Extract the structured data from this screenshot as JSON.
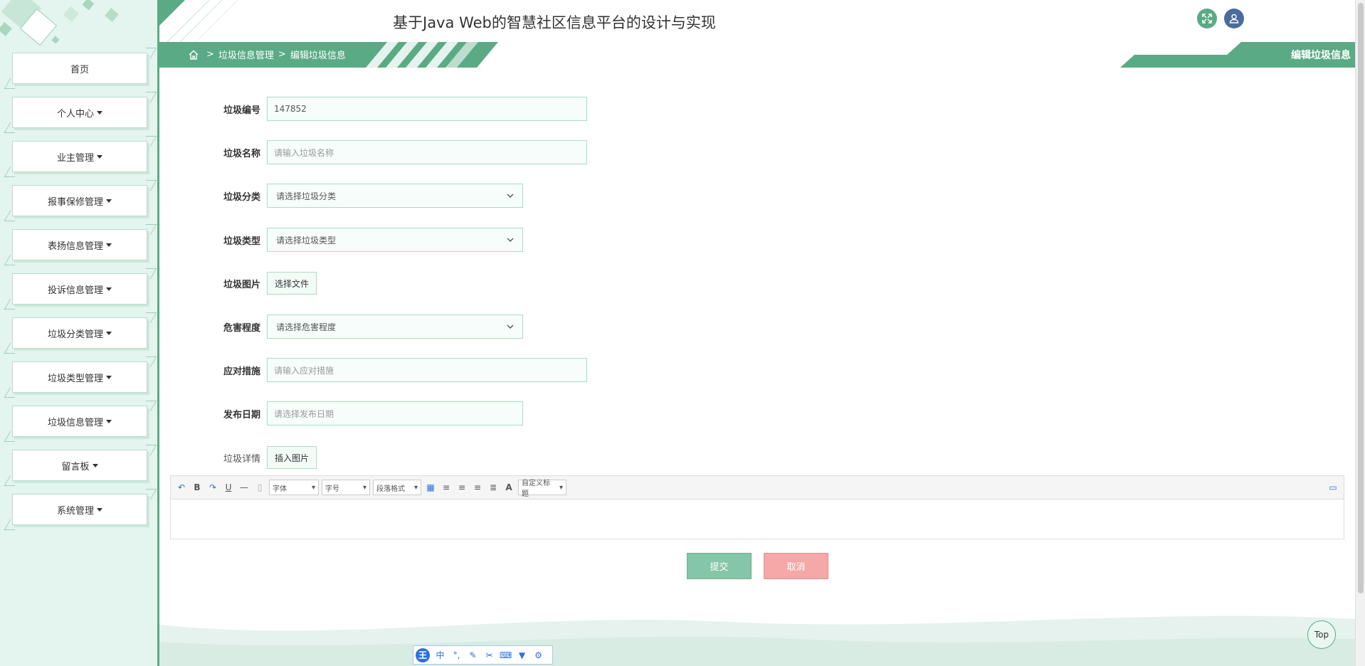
{
  "app": {
    "title": "基于Java Web的智慧社区信息平台的设计与实现"
  },
  "sidebar": {
    "items": [
      {
        "label": "首页",
        "has_caret": false
      },
      {
        "label": "个人中心",
        "has_caret": true
      },
      {
        "label": "业主管理",
        "has_caret": true
      },
      {
        "label": "报事保修管理",
        "has_caret": true
      },
      {
        "label": "表扬信息管理",
        "has_caret": true
      },
      {
        "label": "投诉信息管理",
        "has_caret": true
      },
      {
        "label": "垃圾分类管理",
        "has_caret": true
      },
      {
        "label": "垃圾类型管理",
        "has_caret": true
      },
      {
        "label": "垃圾信息管理",
        "has_caret": true
      },
      {
        "label": "留言板",
        "has_caret": true
      },
      {
        "label": "系统管理",
        "has_caret": true
      }
    ]
  },
  "breadcrumb": {
    "sep": ">",
    "level1": "垃圾信息管理",
    "level2": "编辑垃圾信息",
    "right_title": "编辑垃圾信息"
  },
  "form": {
    "garbage_id": {
      "label": "垃圾编号",
      "value": "147852"
    },
    "garbage_name": {
      "label": "垃圾名称",
      "placeholder": "请输入垃圾名称"
    },
    "garbage_category": {
      "label": "垃圾分类",
      "selected": "请选择垃圾分类"
    },
    "garbage_type": {
      "label": "垃圾类型",
      "selected": "请选择垃圾类型"
    },
    "garbage_image": {
      "label": "垃圾图片",
      "button": "选择文件"
    },
    "hazard_level": {
      "label": "危害程度",
      "selected": "请选择危害程度"
    },
    "countermeasure": {
      "label": "应对措施",
      "placeholder": "请输入应对措施"
    },
    "publish_date": {
      "label": "发布日期",
      "placeholder": "请选择发布日期"
    },
    "garbage_detail": {
      "label": "垃圾详情",
      "button": "插入图片"
    }
  },
  "editor": {
    "font_family": "字体",
    "font_size": "字号",
    "paragraph": "段落格式",
    "custom_title": "自定义标题",
    "icons": {
      "bold": "B",
      "underline": "U",
      "color": "A"
    }
  },
  "buttons": {
    "submit": "提交",
    "cancel": "取消",
    "top": "Top"
  },
  "ime": {
    "logo": "王",
    "lang": "中",
    "punct": "°,"
  },
  "colors": {
    "accent": "#5aaa86",
    "sidebar_bg": "#e4f4ee",
    "cancel": "#f5a8a8",
    "submit": "#86c6a8",
    "user_btn": "#4a6c9c"
  }
}
